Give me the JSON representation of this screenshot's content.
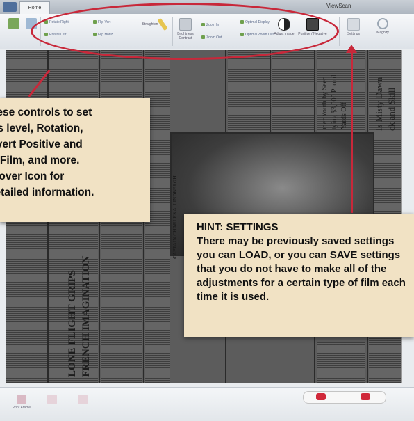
{
  "window": {
    "title": "ViewScan"
  },
  "tabs": [
    {
      "label": "Home"
    }
  ],
  "ribbon": {
    "buttons": {
      "rotate_right": "Rotate Right",
      "rotate_left": "Rotate Left",
      "flip_vert": "Flip Vert",
      "flip_horiz": "Flip Horiz",
      "straighten": "Straighten",
      "brightness": "Brightness Contrast",
      "zoom_in": "Zoom In",
      "zoom_out": "Zoom Out",
      "optimal_display": "Optimal Display",
      "optimal_zoom_out": "Optimal Zoom Out",
      "adjust_image": "Adjust Image",
      "film_type": "Positive / Negative",
      "settings": "Settings",
      "magnify": "Magnify"
    }
  },
  "callouts": {
    "controls": [
      "Use these controls to set",
      "Brightness level, Rotation,",
      "to Invert Positive and",
      "Negative Film, and more.",
      "Mouse over Icon for",
      "detailed information."
    ],
    "hint": [
      "HINT: SETTINGS",
      "There may be previously saved settings",
      "you can LOAD, or you can SAVE settings",
      "that you do not have to make all of the",
      "adjustments for a certain type of film each",
      "time it is used."
    ]
  },
  "newspaper": {
    "headlines": [
      "LONE FLIGHT GRIPS",
      "FRENCH IMAGINATION",
      "CAPTAIN CHARLES A. LINDBERGH"
    ],
    "columns_text": [
      "Is Misty Dawn",
      "ck and Skill",
      "ider Youth by Seer",
      "tying $3,000 Pound",
      "Yards Off"
    ]
  },
  "bottombar": {
    "print_label": "Print Frame"
  },
  "colors": {
    "annotation_red": "#c8283a",
    "callout_bg": "#f1e2c4",
    "ribbon_bg": "#e6eaee"
  }
}
